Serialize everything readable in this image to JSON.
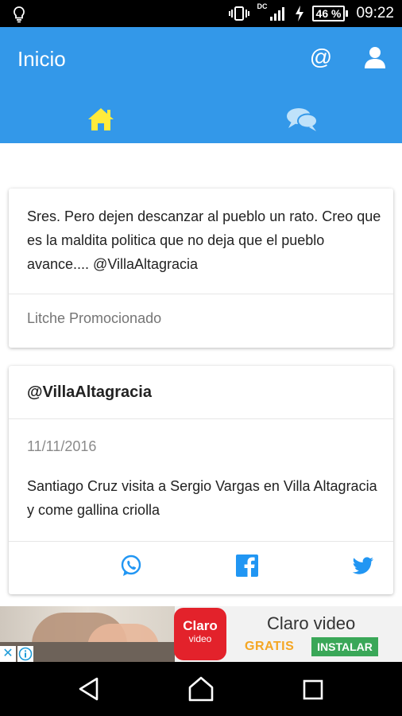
{
  "status_bar": {
    "network_label": "DC",
    "battery": "46 %",
    "time": "09:22"
  },
  "app_bar": {
    "title": "Inicio",
    "mention_glyph": "@",
    "tabs": [
      {
        "name": "home",
        "icon": "home-icon",
        "active": true,
        "color": "#ffeb3b"
      },
      {
        "name": "chat",
        "icon": "chat-icon",
        "active": false
      }
    ],
    "color": "#3398e9"
  },
  "feed": {
    "posts": [
      {
        "text": "Sres. Pero dejen descanzar al pueblo un rato. Creo que es la maldita politica que no deja que el pueblo avance.... @VillaAltagracia",
        "footer": "Litche Promocionado"
      },
      {
        "title": "@VillaAltagracia",
        "date": "11/11/2016",
        "text": "Santiago Cruz visita a Sergio Vargas en Villa Altagracia y come gallina criolla",
        "share": [
          "whatsapp-icon",
          "facebook-icon",
          "twitter-icon"
        ]
      }
    ]
  },
  "ad": {
    "logo_line1": "Claro",
    "logo_line2": "video",
    "title": "Claro video",
    "tag": "GRATIS",
    "install_label": "INSTALAR",
    "close_glyph": "✕"
  }
}
